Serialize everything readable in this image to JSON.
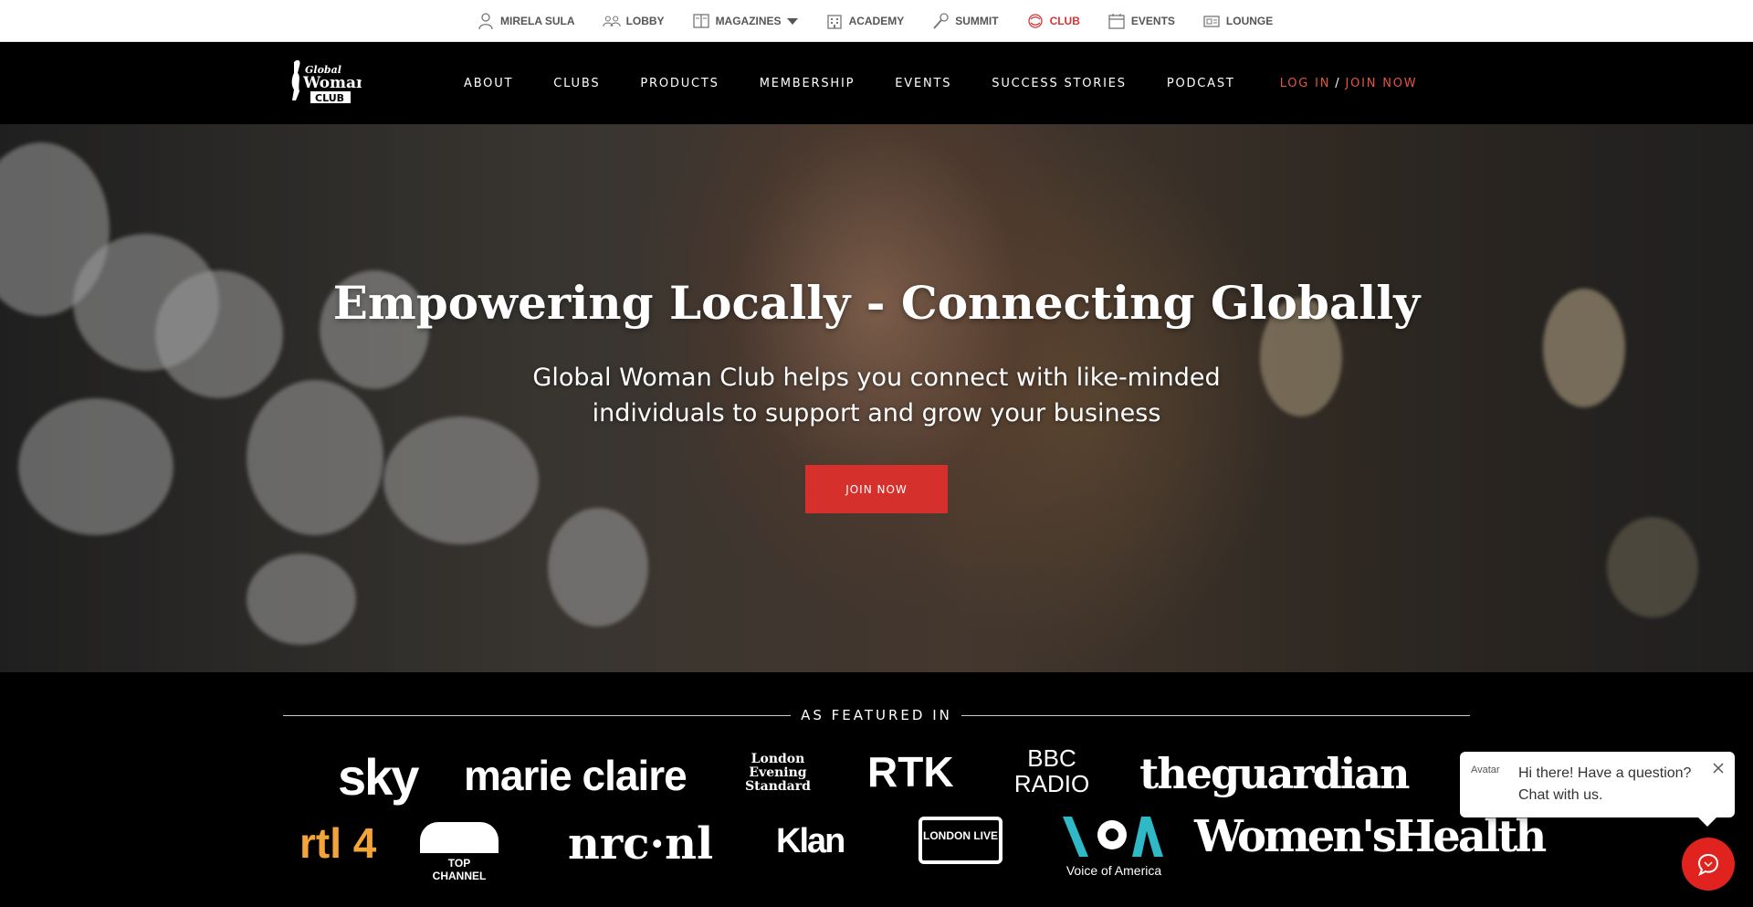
{
  "topbar": {
    "items": [
      {
        "label": "MIRELA SULA",
        "icon": "person-icon"
      },
      {
        "label": "LOBBY",
        "icon": "group-icon"
      },
      {
        "label": "MAGAZINES",
        "icon": "magazine-icon"
      },
      {
        "label": "ACADEMY",
        "icon": "building-icon"
      },
      {
        "label": "SUMMIT",
        "icon": "microphone-icon"
      },
      {
        "label": "CLUB",
        "icon": "club-icon"
      },
      {
        "label": "EVENTS",
        "icon": "calendar-icon"
      },
      {
        "label": "LOUNGE",
        "icon": "lounge-icon"
      }
    ],
    "active_color": "#d63535"
  },
  "brand": {
    "logo_line1": "Global",
    "logo_line2": "Woman",
    "logo_line3": "CLUB"
  },
  "nav": {
    "links": [
      "ABOUT",
      "CLUBS",
      "PRODUCTS",
      "MEMBERSHIP",
      "EVENTS",
      "SUCCESS STORIES",
      "PODCAST"
    ],
    "login": "LOG IN",
    "separator": "/",
    "join": "JOIN NOW",
    "accent": "#e2553f"
  },
  "hero": {
    "title": "Empowering Locally - Connecting Globally",
    "subtitle": "Global Woman Club helps you connect with like-minded individuals to support and grow your business",
    "cta": "JOIN NOW",
    "cta_color": "#d6302c"
  },
  "featured": {
    "heading": "AS FEATURED IN",
    "row1": [
      "sky",
      "marie claire",
      "London Evening Standard",
      "RTK",
      "BBC RADIO",
      "theguardian"
    ],
    "row2": [
      "rtl 4",
      "TOP CHANNEL",
      "nrc·nl",
      "Klan",
      "LONDON LIVE",
      "Voice of America",
      "Women'sHealth"
    ]
  },
  "chat": {
    "avatar_alt": "Avatar",
    "message": "Hi there! Have a question? Chat with us.",
    "button_color": "#e0231f"
  }
}
